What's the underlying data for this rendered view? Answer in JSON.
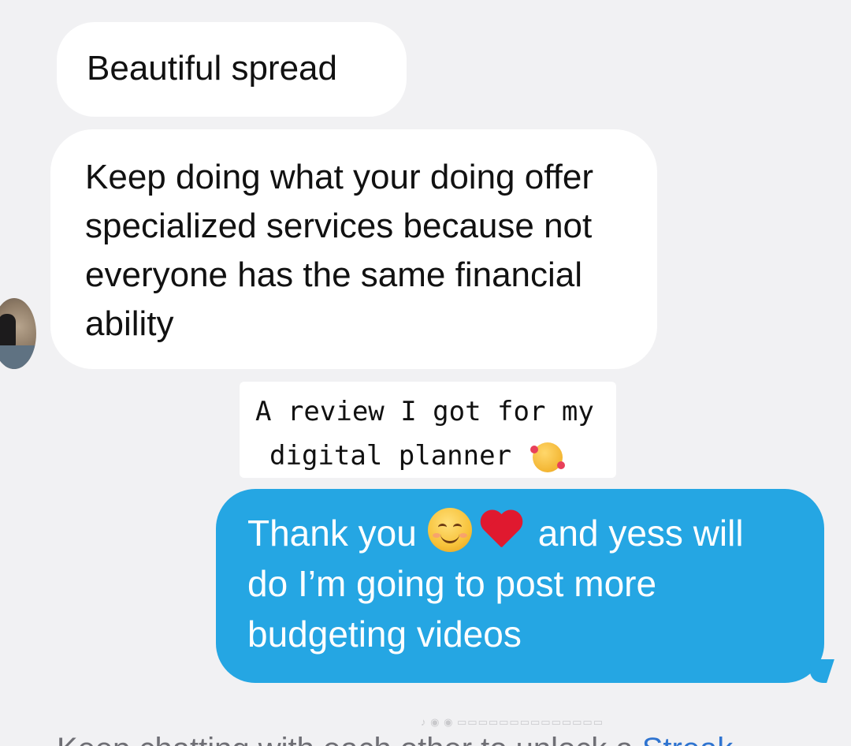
{
  "messages": {
    "incoming_1": "Beautiful spread",
    "incoming_2": "Keep doing what your doing offer specialized services because not everyone has the same financial ability",
    "outgoing_before_emoji": "Thank you",
    "outgoing_after_emoji": "and yess will do I’m going to post more budgeting videos"
  },
  "caption": {
    "line1": "A review I got for my",
    "line2": "digital planner"
  },
  "footer": {
    "text": "Keep chatting with each other to unlock a ",
    "link": "Streak"
  },
  "icons": {
    "caption_emojis": [
      "smiling-face-with-hearts-icon",
      "heart-hands-icon"
    ],
    "message_emojis": [
      "smiling-face-icon",
      "red-heart-icon"
    ]
  },
  "colors": {
    "background": "#f1f1f3",
    "incoming_bubble": "#ffffff",
    "outgoing_bubble": "#25a6e3",
    "link": "#2f74d0"
  }
}
